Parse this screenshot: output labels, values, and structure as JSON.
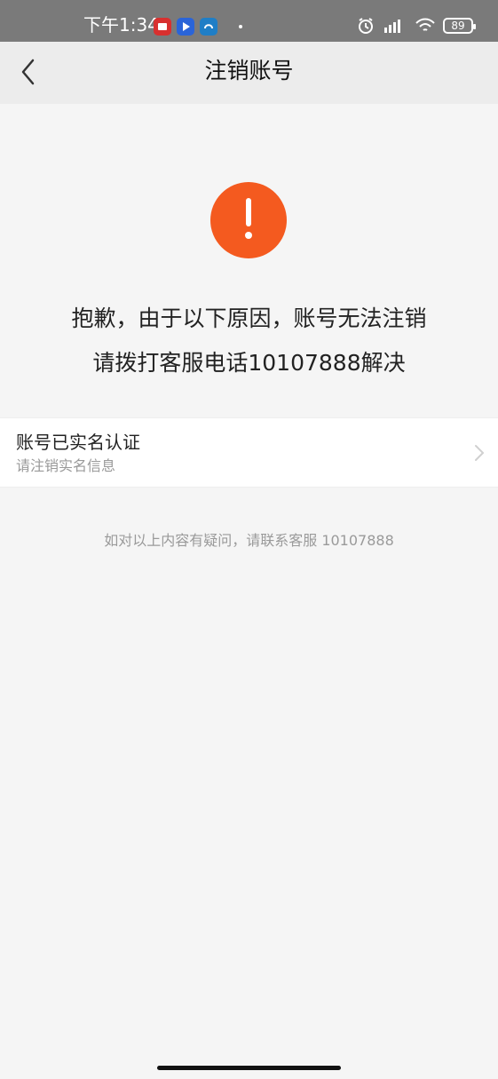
{
  "status_bar": {
    "time": "下午1:34",
    "battery": "89",
    "app_icons": [
      {
        "name": "red-app-icon"
      },
      {
        "name": "play-app-icon"
      },
      {
        "name": "blue-app-icon"
      }
    ],
    "right_icons": [
      "alarm-icon",
      "signal-icon",
      "wifi-icon",
      "battery-icon"
    ]
  },
  "nav": {
    "title": "注销账号",
    "back_icon": "back-arrow-icon"
  },
  "warning": {
    "icon": "exclamation-icon",
    "line1": "抱歉，由于以下原因，账号无法注销",
    "line2": "请拨打客服电话10107888解决"
  },
  "reason": {
    "title": "账号已实名认证",
    "subtitle": "请注销实名信息",
    "chevron_icon": "chevron-right-icon"
  },
  "help": {
    "text": "如对以上内容有疑问，请联系客服 10107888"
  },
  "colors": {
    "status_bar": "#7a7a7a",
    "nav_bar": "#ececec",
    "page_background": "#f5f5f5",
    "warning": "#f45a1f",
    "secondary_text": "#999999"
  }
}
